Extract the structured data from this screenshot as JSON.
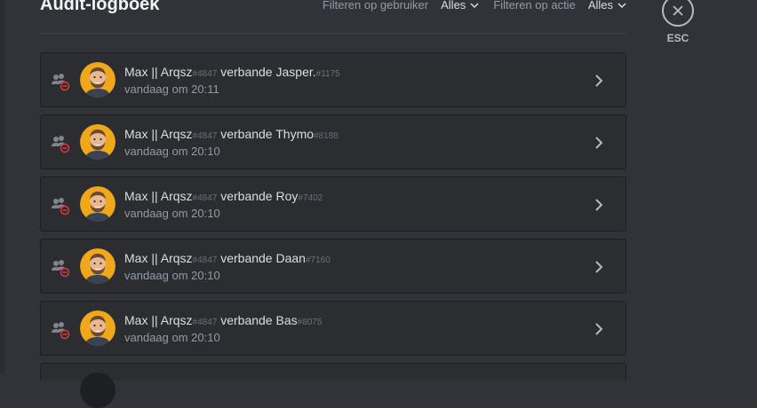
{
  "header": {
    "title": "Audit-logboek",
    "filter_user_label": "Filteren op gebruiker",
    "filter_user_value": "Alles",
    "filter_action_label": "Filteren op actie",
    "filter_action_value": "Alles"
  },
  "close": {
    "label": "ESC",
    "icon": "close-icon"
  },
  "entries": [
    {
      "actor": "Max || Arqsz",
      "actor_disc": "#4847",
      "action": "verbande",
      "target": "Jasper.",
      "target_disc": "#1175",
      "time": "vandaag om 20:11"
    },
    {
      "actor": "Max || Arqsz",
      "actor_disc": "#4847",
      "action": "verbande",
      "target": "Thymo",
      "target_disc": "#8188",
      "time": "vandaag om 20:10"
    },
    {
      "actor": "Max || Arqsz",
      "actor_disc": "#4847",
      "action": "verbande",
      "target": "Roy",
      "target_disc": "#7402",
      "time": "vandaag om 20:10"
    },
    {
      "actor": "Max || Arqsz",
      "actor_disc": "#4847",
      "action": "verbande",
      "target": "Daan",
      "target_disc": "#7160",
      "time": "vandaag om 20:10"
    },
    {
      "actor": "Max || Arqsz",
      "actor_disc": "#4847",
      "action": "verbande",
      "target": "Bas",
      "target_disc": "#8075",
      "time": "vandaag om 20:10"
    }
  ],
  "colors": {
    "background": "#313338",
    "entry_bg": "#2b2d31",
    "ban_red": "#da373c",
    "avatar_orange": "#f0a81a"
  }
}
